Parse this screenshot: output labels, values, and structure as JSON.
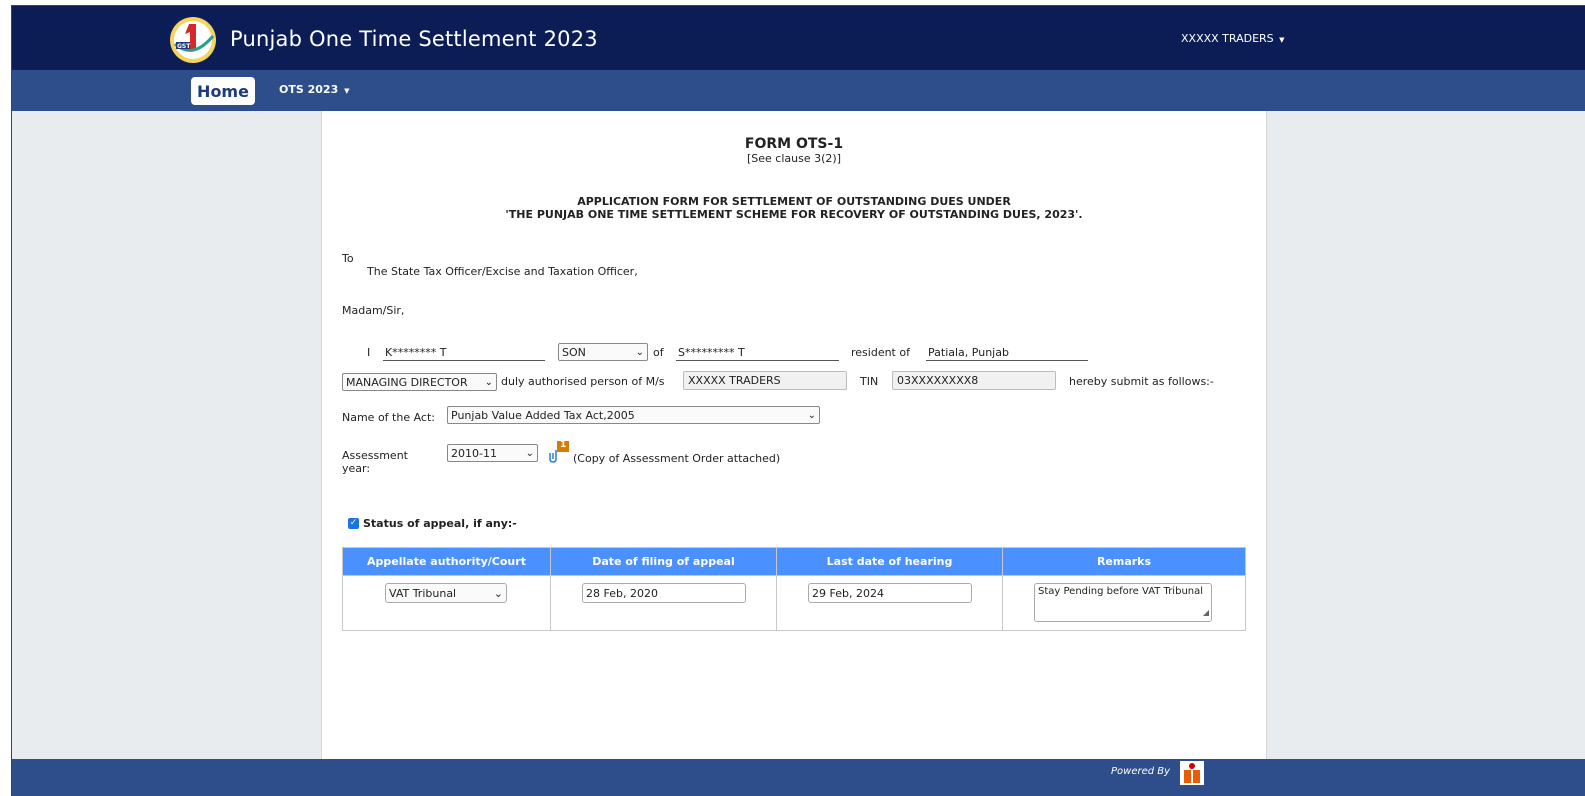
{
  "header": {
    "app_title": "Punjab One Time Settlement 2023",
    "logo_name": "one-nation-one-tax-logo",
    "user_menu_label": "XXXXX TRADERS"
  },
  "nav": {
    "home_label": "Home",
    "ots_menu_label": "OTS 2023"
  },
  "form": {
    "title": "FORM OTS-1",
    "clause": "[See clause 3(2)]",
    "heading_line1": "APPLICATION FORM FOR SETTLEMENT OF OUTSTANDING DUES UNDER",
    "heading_line2": "'THE PUNJAB ONE TIME SETTLEMENT SCHEME FOR RECOVERY OF OUTSTANDING DUES, 2023'.",
    "to_label": "To",
    "addressee": "The State Tax Officer/Excise and Taxation Officer,",
    "salutation": "Madam/Sir,",
    "i_label": "I",
    "applicant_name": "K******** T",
    "relation": "SON",
    "of_label": "of",
    "parent_name": "S********* T",
    "resident_label": "resident of",
    "resident_value": "Patiala, Punjab",
    "designation": "MANAGING DIRECTOR",
    "duly_authorised_text": "duly authorised person of M/s",
    "firm_name": "XXXXX TRADERS",
    "tin_label": "TIN",
    "tin_value": "03XXXXXXXX8",
    "hereby_text": "hereby submit as follows:-",
    "act_label": "Name of the Act:",
    "act_value": "Punjab Value Added Tax Act,2005",
    "assessment_label_1": "Assessment",
    "assessment_label_2": "year:",
    "assessment_year": "2010-11",
    "attachment_count": "1",
    "attachment_note": "(Copy of Assessment Order attached)"
  },
  "appeal": {
    "checkbox_label": "Status of appeal, if any:-",
    "checked": true,
    "columns": [
      "Appellate authority/Court",
      "Date of filing of appeal",
      "Last date of hearing",
      "Remarks"
    ],
    "row": {
      "authority": "VAT Tribunal",
      "filing_date": "28 Feb, 2020",
      "hearing_date": "29 Feb, 2024",
      "remarks": "Stay Pending before VAT Tribunal"
    }
  },
  "footer": {
    "powered_by": "Powered By"
  },
  "colors": {
    "topbar": "#0c1d55",
    "navbar": "#2d4e8a",
    "table_header": "#4a90ff",
    "background": "#e9ecef"
  }
}
